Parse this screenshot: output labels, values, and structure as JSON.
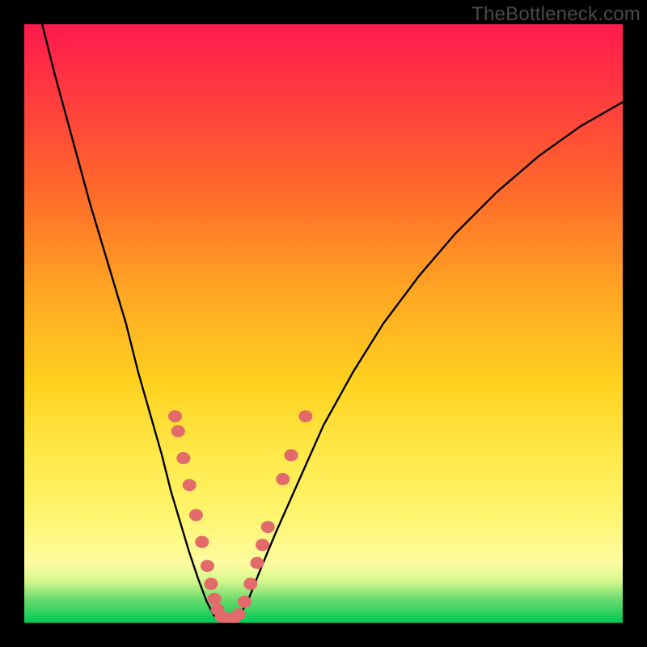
{
  "watermark": "TheBottleneck.com",
  "chart_data": {
    "type": "line",
    "title": "",
    "xlabel": "",
    "ylabel": "",
    "xlim": [
      0,
      100
    ],
    "ylim": [
      0,
      100
    ],
    "grid": false,
    "series": [
      {
        "name": "left-curve",
        "x": [
          3,
          5,
          8,
          11,
          14,
          17,
          19,
          21,
          23,
          24.5,
          26,
          27.5,
          29,
          30.5,
          31.7
        ],
        "y": [
          100,
          92,
          81,
          70,
          60,
          50,
          42,
          35,
          28,
          22,
          17,
          12,
          7.5,
          3.5,
          1.2
        ]
      },
      {
        "name": "valley-floor",
        "x": [
          31.7,
          33,
          34.5,
          36
        ],
        "y": [
          1.2,
          0.6,
          0.6,
          1.2
        ]
      },
      {
        "name": "right-curve",
        "x": [
          36,
          37.5,
          39.5,
          42,
          46,
          50,
          55,
          60,
          66,
          72,
          79,
          86,
          93,
          100
        ],
        "y": [
          1.2,
          4,
          9,
          15,
          24,
          33,
          42,
          50,
          58,
          65,
          72,
          78,
          83,
          87
        ]
      }
    ],
    "markers": {
      "name": "highlight-dots",
      "color": "#e36a6a",
      "points": [
        {
          "x": 25.2,
          "y": 34.5
        },
        {
          "x": 25.7,
          "y": 32.0
        },
        {
          "x": 26.6,
          "y": 27.5
        },
        {
          "x": 27.6,
          "y": 23.0
        },
        {
          "x": 28.7,
          "y": 18.0
        },
        {
          "x": 29.7,
          "y": 13.5
        },
        {
          "x": 30.6,
          "y": 9.5
        },
        {
          "x": 31.2,
          "y": 6.5
        },
        {
          "x": 31.8,
          "y": 4.0
        },
        {
          "x": 32.3,
          "y": 2.2
        },
        {
          "x": 33.0,
          "y": 1.0
        },
        {
          "x": 33.9,
          "y": 0.7
        },
        {
          "x": 35.0,
          "y": 0.7
        },
        {
          "x": 35.8,
          "y": 1.4
        },
        {
          "x": 36.8,
          "y": 3.5
        },
        {
          "x": 37.8,
          "y": 6.5
        },
        {
          "x": 38.9,
          "y": 10.0
        },
        {
          "x": 39.8,
          "y": 13.0
        },
        {
          "x": 40.7,
          "y": 16.0
        },
        {
          "x": 43.2,
          "y": 24.0
        },
        {
          "x": 44.6,
          "y": 28.0
        },
        {
          "x": 47.0,
          "y": 34.5
        }
      ]
    },
    "gradient_stops": [
      {
        "pct": 0,
        "color": "#ff1a4d"
      },
      {
        "pct": 12,
        "color": "#ff3b3f"
      },
      {
        "pct": 28,
        "color": "#ff6a2a"
      },
      {
        "pct": 44,
        "color": "#ffa423"
      },
      {
        "pct": 60,
        "color": "#ffd21f"
      },
      {
        "pct": 72,
        "color": "#ffe94a"
      },
      {
        "pct": 82,
        "color": "#fff56e"
      },
      {
        "pct": 90,
        "color": "#fdfca0"
      },
      {
        "pct": 93,
        "color": "#d7f78d"
      },
      {
        "pct": 96,
        "color": "#6edc6e"
      },
      {
        "pct": 100,
        "color": "#00c853"
      }
    ]
  }
}
